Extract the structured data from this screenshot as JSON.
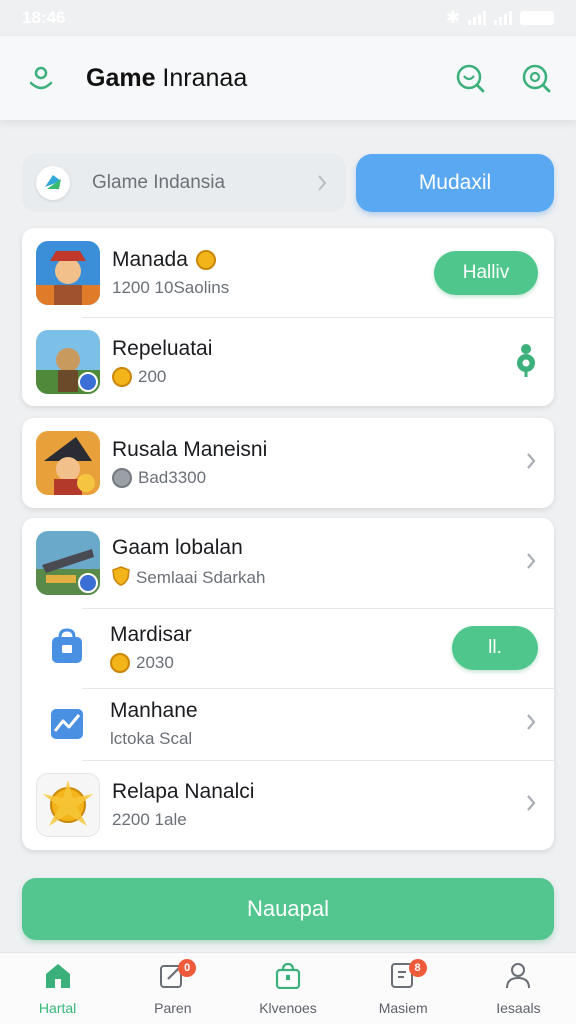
{
  "status": {
    "time": "18:46"
  },
  "header": {
    "title_bold": "Game",
    "title_rest": " Inranaa"
  },
  "search": {
    "text": "Glame Indansia"
  },
  "primary_button": {
    "label": "Mudaxil"
  },
  "cards": [
    {
      "rows": [
        {
          "title": "Manada",
          "subtitle": "1200 10Saolins",
          "action": "Halliv"
        },
        {
          "title": "Repeluatai",
          "subtitle": "200"
        }
      ]
    },
    {
      "rows": [
        {
          "title": "Rusala Maneisni",
          "subtitle": "Bad3300"
        }
      ]
    },
    {
      "rows": [
        {
          "title": "Gaam lobalan",
          "subtitle": "Semlaai Sdarkah"
        },
        {
          "title": "Mardisar",
          "subtitle": "2030",
          "action": "ll."
        },
        {
          "title": "Manhane",
          "subtitle": "lctoka Scal"
        },
        {
          "title": "Relapa Nanalci",
          "subtitle": "2200 1ale"
        }
      ]
    }
  ],
  "bottom_button": {
    "label": "Nauapal"
  },
  "tabs": [
    {
      "label": "Hartal",
      "active": true
    },
    {
      "label": "Paren",
      "badge": "0"
    },
    {
      "label": "Klvenoes"
    },
    {
      "label": "Masiem",
      "badge": "8"
    },
    {
      "label": "Iesaals"
    }
  ],
  "colors": {
    "accent_green": "#4fc68c",
    "accent_blue": "#5aa7f2"
  }
}
